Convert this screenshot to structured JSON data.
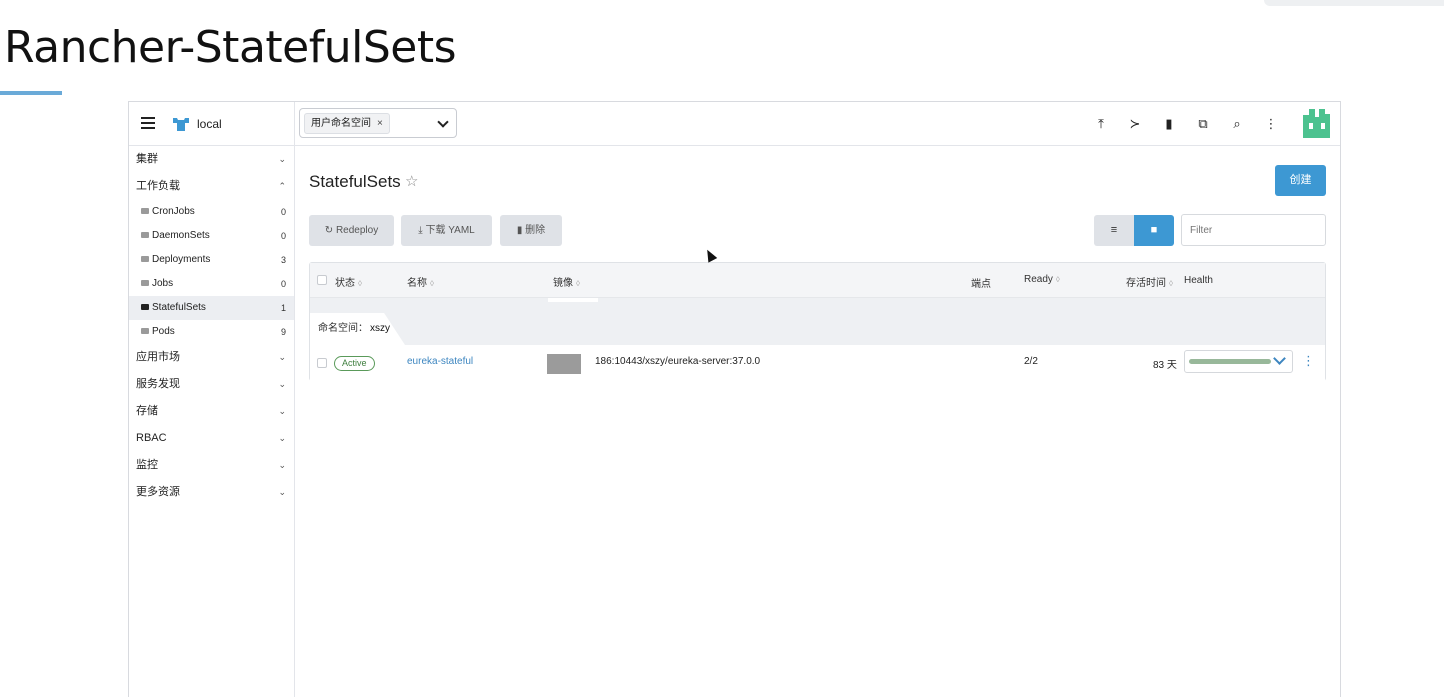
{
  "slide": {
    "title": "Rancher-StatefulSets"
  },
  "header": {
    "cluster_name": "local",
    "namespace_chip": "用户命名空间",
    "namespace_chip_remove": "×",
    "icons": [
      "upload-icon",
      "terminal-icon",
      "file-icon",
      "copy-icon",
      "search-icon",
      "more-vertical-icon"
    ],
    "icon_glyphs": [
      "⤒",
      "≻",
      "▮",
      "⧉",
      "⌕",
      "⋮"
    ]
  },
  "sidebar": {
    "groups_top": [
      {
        "label": "集群",
        "chevron": "⌄"
      },
      {
        "label": "工作负载",
        "chevron": "⌃"
      }
    ],
    "workload_items": [
      {
        "label": "CronJobs",
        "count": "0"
      },
      {
        "label": "DaemonSets",
        "count": "0"
      },
      {
        "label": "Deployments",
        "count": "3"
      },
      {
        "label": "Jobs",
        "count": "0"
      },
      {
        "label": "StatefulSets",
        "count": "1"
      },
      {
        "label": "Pods",
        "count": "9"
      }
    ],
    "groups_bottom": [
      {
        "label": "应用市场",
        "chevron": "⌄"
      },
      {
        "label": "服务发现",
        "chevron": "⌄"
      },
      {
        "label": "存储",
        "chevron": "⌄"
      },
      {
        "label": "RBAC",
        "chevron": "⌄"
      },
      {
        "label": "监控",
        "chevron": "⌄"
      },
      {
        "label": "更多资源",
        "chevron": "⌄"
      }
    ]
  },
  "main": {
    "title": "StatefulSets",
    "star": "☆",
    "create_label": "创建",
    "actions": {
      "redeploy": "↻ Redeploy",
      "download": "⤓ 下载 YAML",
      "delete": "▮ 删除"
    },
    "view_list_glyph": "≡",
    "view_folder_glyph": "■",
    "filter_placeholder": "Filter"
  },
  "table": {
    "headers": {
      "state": "状态",
      "name": "名称",
      "image": "镜像",
      "endpoints": "端点",
      "ready": "Ready",
      "age": "存活时间",
      "health": "Health"
    },
    "sort_glyph": "◊",
    "group": {
      "label": "命名空间：",
      "value": "xszy"
    },
    "rows": [
      {
        "state": "Active",
        "name": "eureka-stateful",
        "image": "186:10443/xszy/eureka-server:37.0.0",
        "ready": "2/2",
        "age": "83 天",
        "health_fraction": 1.0,
        "menu": "⋮"
      }
    ]
  },
  "colors": {
    "accent": "#3d98d3",
    "active_badge": "#3f7f3f",
    "health_bar": "#98b89a",
    "avatar": "#4cc28f"
  }
}
